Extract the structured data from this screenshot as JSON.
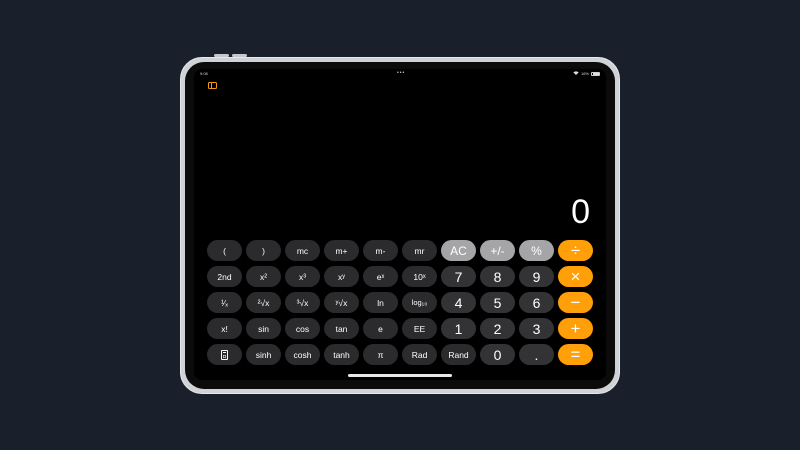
{
  "status_bar": {
    "time": "9:08",
    "dots": "•••",
    "battery": "16%"
  },
  "display": {
    "value": "0"
  },
  "keypad": {
    "rows": [
      [
        {
          "label": "(",
          "type": "sci"
        },
        {
          "label": ")",
          "type": "sci"
        },
        {
          "label": "mc",
          "type": "sci"
        },
        {
          "label": "m+",
          "type": "sci"
        },
        {
          "label": "m-",
          "type": "sci"
        },
        {
          "label": "mr",
          "type": "sci"
        },
        {
          "label": "AC",
          "type": "fn"
        },
        {
          "label": "+/-",
          "type": "fn"
        },
        {
          "label": "%",
          "type": "fn"
        },
        {
          "label": "÷",
          "type": "op"
        }
      ],
      [
        {
          "label": "2nd",
          "type": "sci"
        },
        {
          "label": "x²",
          "type": "sci"
        },
        {
          "label": "x³",
          "type": "sci"
        },
        {
          "label": "xʸ",
          "type": "sci"
        },
        {
          "label": "eˣ",
          "type": "sci"
        },
        {
          "label": "10ˣ",
          "type": "sci"
        },
        {
          "label": "7",
          "type": "num"
        },
        {
          "label": "8",
          "type": "num"
        },
        {
          "label": "9",
          "type": "num"
        },
        {
          "label": "×",
          "type": "op"
        }
      ],
      [
        {
          "label": "¹⁄ₓ",
          "type": "sci"
        },
        {
          "label": "²√x",
          "type": "sci"
        },
        {
          "label": "³√x",
          "type": "sci"
        },
        {
          "label": "ʸ√x",
          "type": "sci"
        },
        {
          "label": "ln",
          "type": "sci"
        },
        {
          "label": "log₁₀",
          "type": "sci"
        },
        {
          "label": "4",
          "type": "num"
        },
        {
          "label": "5",
          "type": "num"
        },
        {
          "label": "6",
          "type": "num"
        },
        {
          "label": "−",
          "type": "op"
        }
      ],
      [
        {
          "label": "x!",
          "type": "sci"
        },
        {
          "label": "sin",
          "type": "sci"
        },
        {
          "label": "cos",
          "type": "sci"
        },
        {
          "label": "tan",
          "type": "sci"
        },
        {
          "label": "e",
          "type": "sci"
        },
        {
          "label": "EE",
          "type": "sci"
        },
        {
          "label": "1",
          "type": "num"
        },
        {
          "label": "2",
          "type": "num"
        },
        {
          "label": "3",
          "type": "num"
        },
        {
          "label": "+",
          "type": "op"
        }
      ],
      [
        {
          "label": "",
          "type": "sci",
          "icon": "calculator-icon"
        },
        {
          "label": "sinh",
          "type": "sci"
        },
        {
          "label": "cosh",
          "type": "sci"
        },
        {
          "label": "tanh",
          "type": "sci"
        },
        {
          "label": "π",
          "type": "sci"
        },
        {
          "label": "Rad",
          "type": "sci"
        },
        {
          "label": "Rand",
          "type": "sci"
        },
        {
          "label": "0",
          "type": "num"
        },
        {
          "label": ".",
          "type": "num"
        },
        {
          "label": "=",
          "type": "op"
        }
      ]
    ]
  },
  "colors": {
    "operator": "#ff9f0a",
    "function": "#a5a5a8",
    "number": "#333336",
    "scientific": "#2b2b2d",
    "accent": "#f09a0e"
  }
}
